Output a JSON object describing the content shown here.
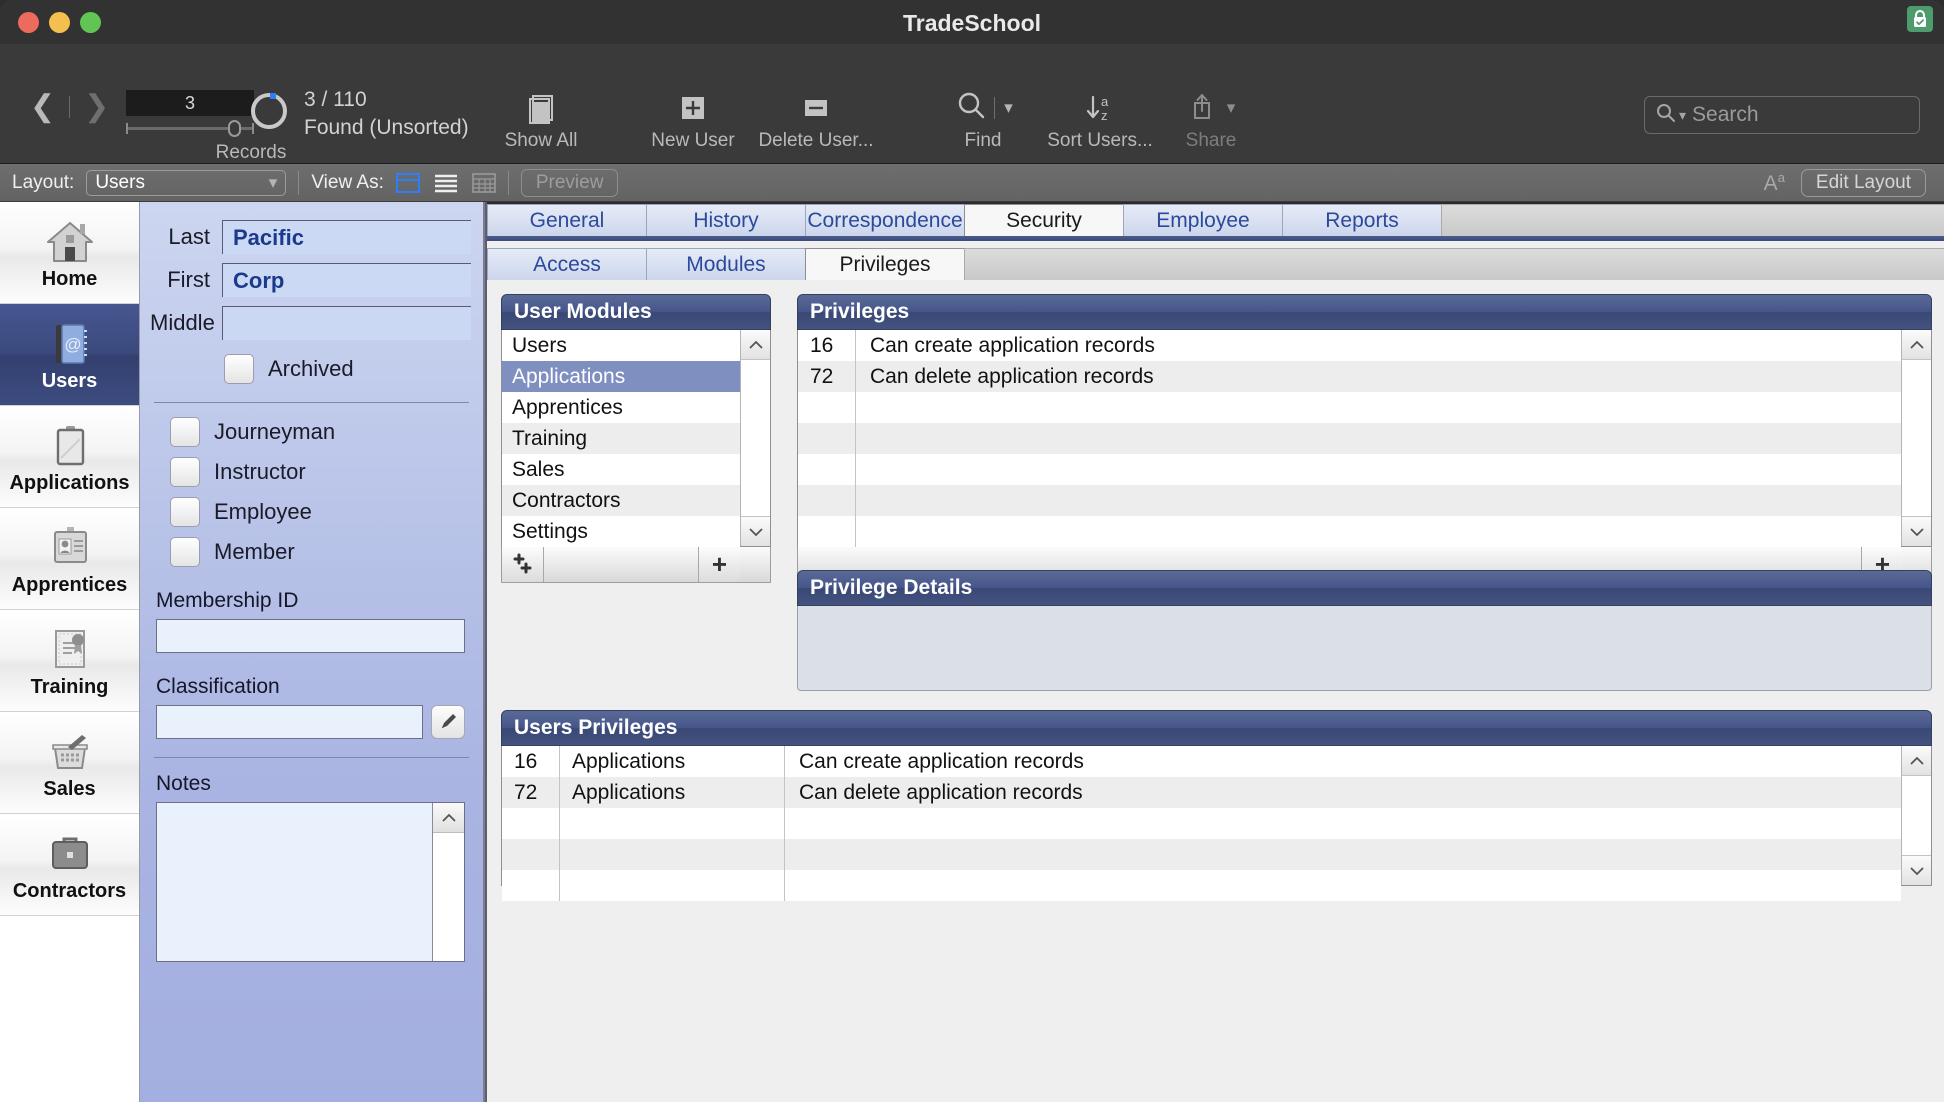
{
  "window": {
    "title": "TradeSchool",
    "lock_icon": "lock-check-icon"
  },
  "toolbar": {
    "record_number": "3",
    "found_count": "3 / 110",
    "found_status": "Found (Unsorted)",
    "records_label": "Records",
    "buttons": [
      {
        "label": "Show All",
        "icon": "records-stack-icon"
      },
      {
        "label": "New User",
        "icon": "plus-square-icon"
      },
      {
        "label": "Delete User...",
        "icon": "minus-square-icon"
      },
      {
        "label": "Find",
        "icon": "search-icon"
      },
      {
        "label": "Sort Users...",
        "icon": "sort-az-icon"
      },
      {
        "label": "Share",
        "icon": "share-icon"
      }
    ],
    "search": {
      "placeholder": "Search",
      "value": ""
    }
  },
  "layoutbar": {
    "layout_label": "Layout:",
    "layout_value": "Users",
    "viewas_label": "View As:",
    "view_modes": [
      "form-view-icon",
      "list-view-icon",
      "table-view-icon"
    ],
    "preview_label": "Preview",
    "text_size_icon": "text-size-icon",
    "edit_layout_label": "Edit Layout"
  },
  "sidebar": {
    "items": [
      {
        "label": "Home",
        "icon": "house-icon",
        "active": false
      },
      {
        "label": "Users",
        "icon": "address-book-icon",
        "active": true
      },
      {
        "label": "Applications",
        "icon": "clipboard-icon",
        "active": false
      },
      {
        "label": "Apprentices",
        "icon": "id-badge-icon",
        "active": false
      },
      {
        "label": "Training",
        "icon": "certificate-icon",
        "active": false
      },
      {
        "label": "Sales",
        "icon": "basket-icon",
        "active": false
      },
      {
        "label": "Contractors",
        "icon": "briefcase-icon",
        "active": false
      }
    ]
  },
  "form": {
    "fields": [
      {
        "label": "Last",
        "value": "Pacific"
      },
      {
        "label": "First",
        "value": "Corp"
      },
      {
        "label": "Middle",
        "value": ""
      }
    ],
    "archived": {
      "label": "Archived",
      "checked": false
    },
    "roles": [
      {
        "label": "Journeyman",
        "checked": false
      },
      {
        "label": "Instructor",
        "checked": false
      },
      {
        "label": "Employee",
        "checked": false
      },
      {
        "label": "Member",
        "checked": false
      }
    ],
    "membership_id": {
      "label": "Membership ID",
      "value": ""
    },
    "classification": {
      "label": "Classification",
      "value": "",
      "edit_icon": "pencil-icon"
    },
    "notes": {
      "label": "Notes",
      "value": ""
    }
  },
  "tabs_primary": [
    {
      "label": "General",
      "active": false
    },
    {
      "label": "History",
      "active": false
    },
    {
      "label": "Correspondence",
      "active": false
    },
    {
      "label": "Security",
      "active": true
    },
    {
      "label": "Employee",
      "active": false
    },
    {
      "label": "Reports",
      "active": false
    }
  ],
  "tabs_secondary": [
    {
      "label": "Access",
      "active": false
    },
    {
      "label": "Modules",
      "active": false
    },
    {
      "label": "Privileges",
      "active": true
    }
  ],
  "user_modules": {
    "title": "User Modules",
    "items": [
      {
        "label": "Users",
        "selected": false
      },
      {
        "label": "Applications",
        "selected": true
      },
      {
        "label": "Apprentices",
        "selected": false
      },
      {
        "label": "Training",
        "selected": false
      },
      {
        "label": "Sales",
        "selected": false
      },
      {
        "label": "Contractors",
        "selected": false
      },
      {
        "label": "Settings",
        "selected": false
      }
    ],
    "add_multi_label": "✚",
    "add_label": "+"
  },
  "privileges": {
    "title": "Privileges",
    "rows": [
      {
        "id": "16",
        "description": "Can create application records"
      },
      {
        "id": "72",
        "description": "Can delete application records"
      },
      {
        "id": "",
        "description": ""
      },
      {
        "id": "",
        "description": ""
      },
      {
        "id": "",
        "description": ""
      },
      {
        "id": "",
        "description": ""
      },
      {
        "id": "",
        "description": ""
      }
    ],
    "add_label": "+"
  },
  "privilege_details": {
    "title": "Privilege Details",
    "content": ""
  },
  "users_privileges": {
    "title": "Users Privileges",
    "rows": [
      {
        "id": "16",
        "module": "Applications",
        "description": "Can create application records"
      },
      {
        "id": "72",
        "module": "Applications",
        "description": "Can delete application records"
      },
      {
        "id": "",
        "module": "",
        "description": ""
      },
      {
        "id": "",
        "module": "",
        "description": ""
      },
      {
        "id": "",
        "module": "",
        "description": ""
      }
    ]
  }
}
